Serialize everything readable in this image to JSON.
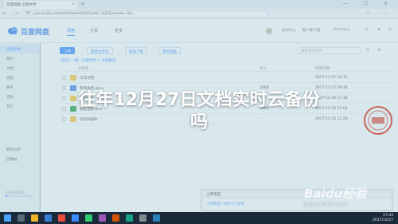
{
  "browser": {
    "tab_title": "百度网盘-全部文件",
    "tab_close": "×",
    "new_tab": "+",
    "window_controls": "— ☐ ✕",
    "nav_buttons": "← → ↻",
    "url": "pan.baidu.com/disk/home#/all?path=%2F&vmode=list",
    "tools": "☆ ⋯"
  },
  "app": {
    "logo_text": "百度网盘",
    "nav": [
      "网盘",
      "分享",
      "更多"
    ],
    "header_links": [
      "会员中心",
      "客户端下载"
    ],
    "username": "zhihuiyun"
  },
  "sidebar": {
    "items": [
      "全部文件",
      "图片",
      "文档",
      "视频",
      "种子",
      "音乐",
      "其它",
      "我的分享",
      "回收站"
    ],
    "quota": "3.9G/2055G"
  },
  "toolbar": {
    "upload": "上传",
    "new_folder": "新建文件夹",
    "offline_download": "离线下载",
    "my_devices": "我的设备",
    "search_placeholder": "搜索您的文件",
    "view_icons": "☰ ⊞"
  },
  "breadcrumb": "返回上一级 | 全部文件 > 文档备份",
  "columns": [
    "文件名",
    "大小",
    "修改日期"
  ],
  "rows": [
    {
      "name": "工作文档",
      "size": "-",
      "date": "2017-12-27 10:15"
    },
    {
      "name": "年终总结.docx",
      "size": "26KB",
      "date": "2017-12-27 09:48"
    },
    {
      "name": "项目资料",
      "size": "-",
      "date": "2017-12-26 17:30"
    },
    {
      "name": "会议记录.xlsx",
      "size": "14KB",
      "date": "2017-12-26 15:02"
    },
    {
      "name": "合同扫描件",
      "size": "-",
      "date": "2017-12-25 11:20"
    }
  ],
  "upload_panel": {
    "title": "上传完成",
    "status": "上传完成 | 共计1个文件"
  },
  "overlay": {
    "headline_line1": "往年12月27日文档实时云备份",
    "headline_line2": "吗",
    "watermark": "Baidu经验",
    "watermark_url": "jingyan.baidu.com"
  },
  "taskbar": {
    "time": "17:43",
    "date": "2017/12/27"
  },
  "colors": {
    "accent": "#3b8cff",
    "folder": "#ffc83d",
    "taskbar": "#1a2a3a"
  }
}
